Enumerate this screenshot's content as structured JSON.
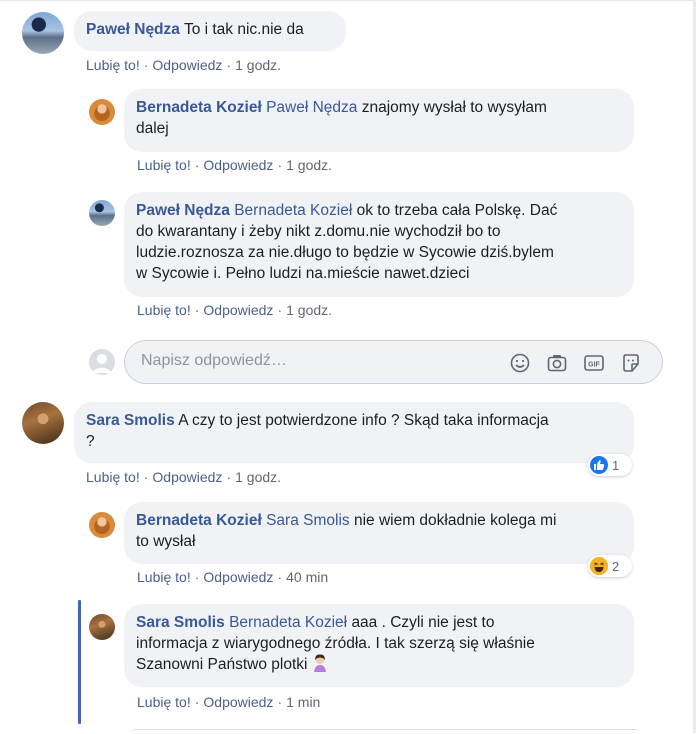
{
  "comments": [
    {
      "author": "Paweł Nędza",
      "text": "To i tak nic.nie da",
      "like": "Lubię to!",
      "reply": "Odpowiedz",
      "time": "1 godz."
    },
    {
      "author": "Bernadeta Kozieł",
      "mention": "Paweł Nędza",
      "text1": "znajomy wysłał to wysyłam",
      "text2": "dalej",
      "like": "Lubię to!",
      "reply": "Odpowiedz",
      "time": "1 godz."
    },
    {
      "author": "Paweł Nędza",
      "mention": "Bernadeta Kozieł",
      "text1": "ok to trzeba cała Polskę. Dać",
      "text2": "do kwarantany i żeby nikt z.domu.nie wychodził bo to",
      "text3": "ludzie.roznosza za nie.długo to będzie w Sycowie dziś.bylem",
      "text4": "w Sycowie i. Pełno ludzi na.mieście nawet.dzieci",
      "like": "Lubię to!",
      "reply": "Odpowiedz",
      "time": "1 godz."
    },
    {
      "author": "Sara Smolis",
      "text1": "A czy to jest potwierdzone info ? Skąd taka informacja",
      "text2": "?",
      "like": "Lubię to!",
      "reply": "Odpowiedz",
      "time": "1 godz.",
      "reaction_count": "1",
      "reaction_type": "like"
    },
    {
      "author": "Bernadeta Kozieł",
      "mention": "Sara Smolis",
      "text1": "nie wiem dokładnie kolega mi",
      "text2": "to wysłał",
      "like": "Lubię to!",
      "reply": "Odpowiedz",
      "time": "40 min",
      "reaction_count": "2",
      "reaction_type": "haha"
    },
    {
      "author": "Sara Smolis",
      "mention": "Bernadeta Kozieł",
      "text1": "aaa . Czyli nie jest to",
      "text2": "informacja z wiarygodnego źródła. I tak szerzą się właśnie",
      "text3": "Szanowni Państwo plotki",
      "like": "Lubię to!",
      "reply": "Odpowiedz",
      "time": "1 min"
    }
  ],
  "reply_box": {
    "placeholder": "Napisz odpowiedź…",
    "icons": [
      "emoji-icon",
      "camera-icon",
      "gif-icon",
      "sticker-icon"
    ]
  },
  "colors": {
    "accent": "#385898",
    "bubble": "#f0f2f5",
    "thread_line": "#4267b2"
  }
}
